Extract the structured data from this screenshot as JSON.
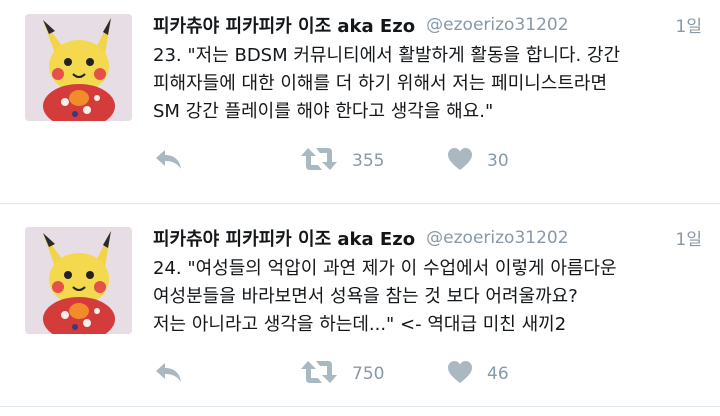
{
  "tweets": [
    {
      "name": "피카츄야 피카피카 이조 aka Ezo",
      "handle": "@ezoerizo31202",
      "time": "1일",
      "lines": [
        "23. \"저는 BDSM 커뮤니티에서 활발하게 활동을 합니다. 강간",
        "피해자들에 대한 이해를 더 하기 위해서 저는 페미니스트라면",
        "SM 강간 플레이를 해야 한다고 생각을 해요.\""
      ],
      "retweets": "355",
      "likes": "30"
    },
    {
      "name": "피카츄야 피카피카 이조 aka Ezo",
      "handle": "@ezoerizo31202",
      "time": "1일",
      "lines": [
        "24. \"여성들의 억압이 과연 제가 이 수업에서 이렇게 아름다운",
        "여성분들을 바라보면서 성욕을 참는 것 보다 어려울까요?",
        "저는 아니라고 생각을 하는데...\" <- 역대급 미친 새끼2"
      ],
      "retweets": "750",
      "likes": "46"
    }
  ],
  "colors": {
    "text": "#14171a",
    "muted": "#8899a6",
    "icon": "#aab8c2",
    "divider": "#e1e8ed"
  },
  "icons": [
    "avatar-pikachu",
    "reply-icon",
    "retweet-icon",
    "heart-icon"
  ]
}
